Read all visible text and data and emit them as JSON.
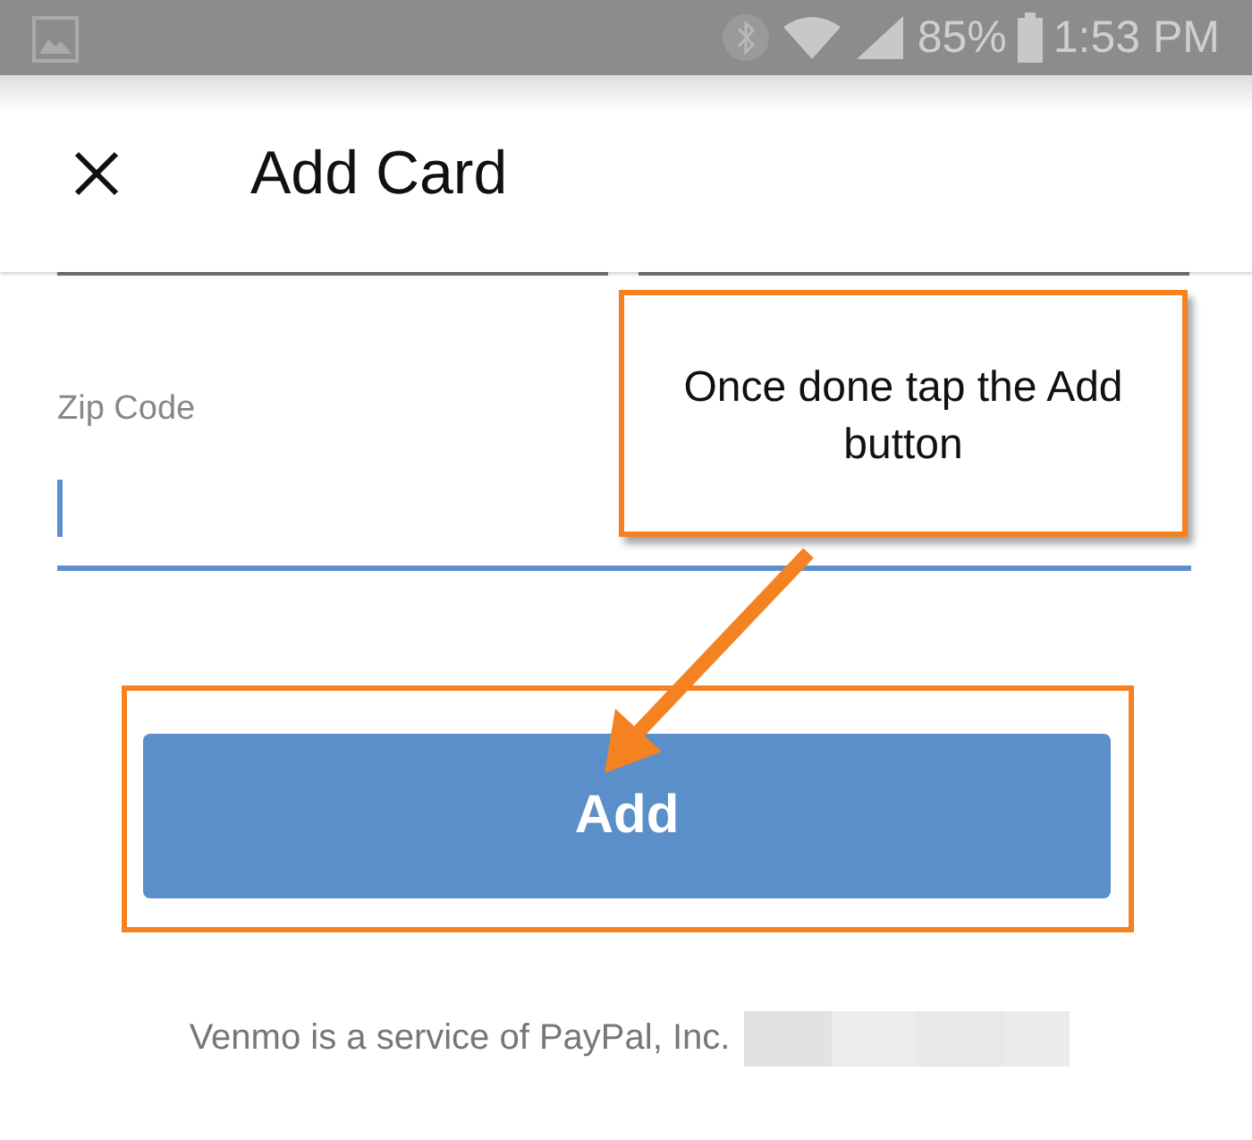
{
  "status_bar": {
    "battery": "85%",
    "time": "1:53 PM"
  },
  "app_bar": {
    "title": "Add Card"
  },
  "zip_field": {
    "label": "Zip Code",
    "focused": true
  },
  "add_button": {
    "label": "Add",
    "highlighted": true
  },
  "callout": {
    "text": "Once done tap the Add button"
  },
  "footer": {
    "text": "Venmo is a service of PayPal, Inc."
  }
}
